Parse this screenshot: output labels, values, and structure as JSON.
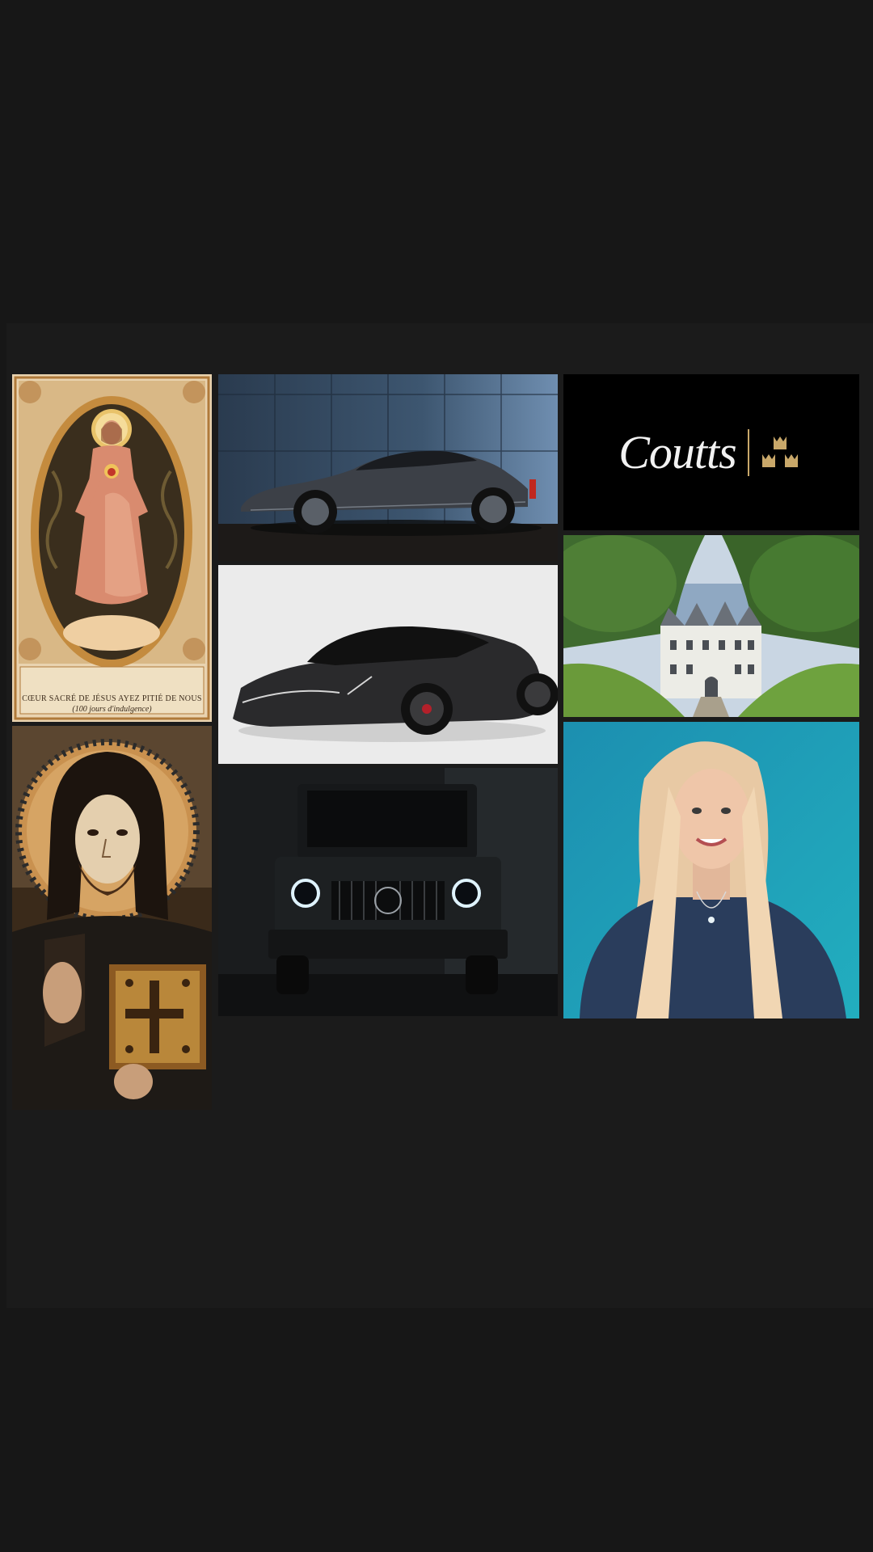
{
  "tiles": {
    "sacred_heart": {
      "caption_line1": "CŒUR SACRÉ DE JÉSUS   AYEZ PITIÉ DE NOUS",
      "caption_line2": "(100 jours d'indulgence)"
    },
    "coutts": {
      "wordmark": "Coutts"
    }
  },
  "colors": {
    "page_bg": "#171717",
    "board_bg": "#1b1b1b",
    "coutts_gold": "#c9a86a",
    "portrait_bg": "#1fa3b8"
  }
}
